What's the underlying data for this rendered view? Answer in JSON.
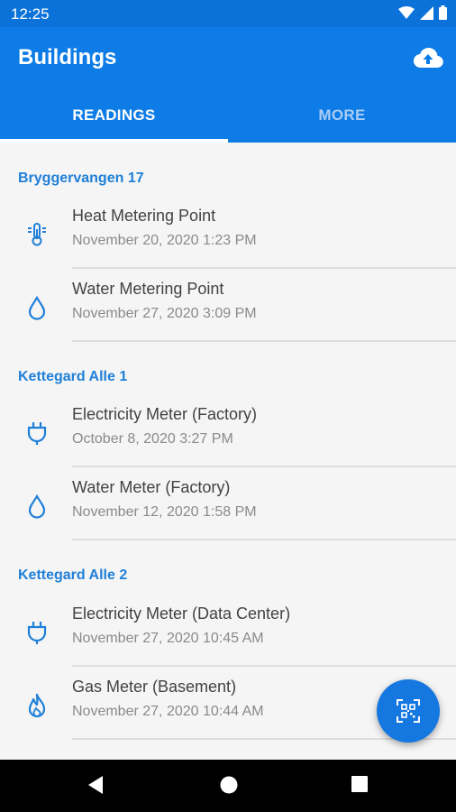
{
  "status_bar": {
    "time": "12:25"
  },
  "app_bar": {
    "title": "Buildings",
    "upload_icon": "cloud-upload-icon"
  },
  "tabs": [
    {
      "label": "READINGS",
      "selected": true
    },
    {
      "label": "MORE",
      "selected": false
    }
  ],
  "groups": [
    {
      "header": "Bryggervangen 17",
      "items": [
        {
          "name": "Heat Metering Point",
          "date": "November 20, 2020 1:23 PM",
          "icon": "thermometer-icon"
        },
        {
          "name": "Water Metering Point",
          "date": "November 27, 2020 3:09 PM",
          "icon": "water-drop-icon"
        }
      ]
    },
    {
      "header": "Kettegard Alle 1",
      "items": [
        {
          "name": "Electricity Meter (Factory)",
          "date": "October 8, 2020 3:27 PM",
          "icon": "plug-icon"
        },
        {
          "name": "Water Meter (Factory)",
          "date": "November 12, 2020 1:58 PM",
          "icon": "water-drop-icon"
        }
      ]
    },
    {
      "header": "Kettegard Alle 2",
      "items": [
        {
          "name": "Electricity Meter (Data Center)",
          "date": "November 27, 2020 10:45 AM",
          "icon": "plug-icon"
        },
        {
          "name": "Gas Meter (Basement)",
          "date": "November 27, 2020 10:44 AM",
          "icon": "flame-icon"
        }
      ]
    }
  ],
  "fab": {
    "icon": "qr-scan-icon"
  },
  "colors": {
    "primary": "#0d7ce6",
    "accent_text": "#1f7fd8",
    "fab": "#1478e0"
  }
}
